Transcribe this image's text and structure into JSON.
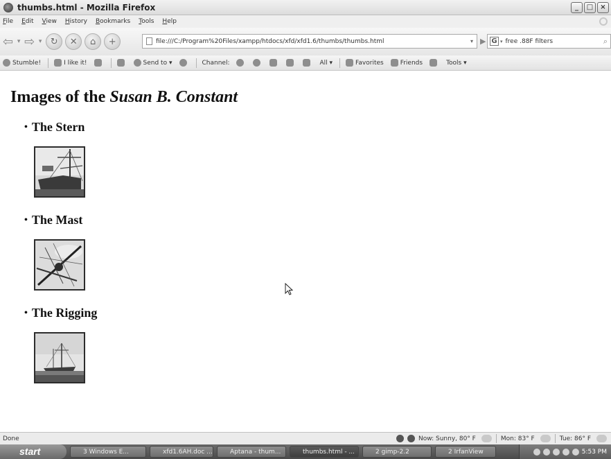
{
  "window": {
    "title": "thumbs.html - Mozilla Firefox",
    "controls": [
      "_",
      "□",
      "×"
    ]
  },
  "menu": [
    "File",
    "Edit",
    "View",
    "History",
    "Bookmarks",
    "Tools",
    "Help"
  ],
  "navigation": {
    "url": "file:///C:/Program%20Files/xampp/htdocs/xfd/xfd1.6/thumbs/thumbs.html",
    "search_value": "free .88F filters",
    "search_engine_icon": "G"
  },
  "toolbar": {
    "stumble": "Stumble!",
    "like": "I like it!",
    "send_to": "Send to",
    "channel": "Channel:",
    "all": "All",
    "favorites": "Favorites",
    "friends": "Friends",
    "tools": "Tools"
  },
  "page": {
    "title_plain": "Images of the ",
    "title_italic": "Susan B. Constant",
    "sections": [
      {
        "heading": "The Stern",
        "thumbnail": "ship stern with tall mast"
      },
      {
        "heading": "The Mast",
        "thumbnail": "mast and rigging against sky"
      },
      {
        "heading": "The Rigging",
        "thumbnail": "ship rigging on water"
      }
    ]
  },
  "status": {
    "text": "Done",
    "weather_now": "Now: Sunny, 80° F",
    "weather_mon": "Mon: 83° F",
    "weather_tue": "Tue: 86° F"
  },
  "taskbar": {
    "start": "start",
    "tasks": [
      {
        "label": "3 Windows E...",
        "active": false
      },
      {
        "label": "xfd1.6AH.doc ...",
        "active": false
      },
      {
        "label": "Aptana - thum...",
        "active": false
      },
      {
        "label": "thumbs.html - ...",
        "active": true
      },
      {
        "label": "2 gimp-2.2",
        "active": false
      },
      {
        "label": "2 IrfanView",
        "active": false
      }
    ],
    "clock": "5:53 PM"
  }
}
